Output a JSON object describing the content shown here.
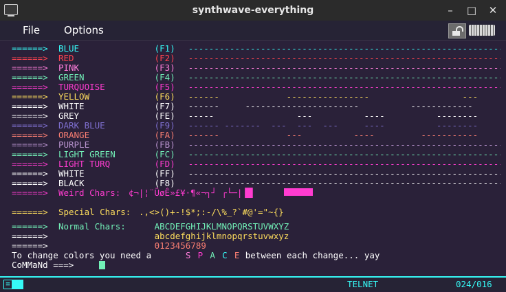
{
  "window": {
    "title": "synthwave-everything"
  },
  "window_controls": {
    "minimize": "–",
    "maximize": "□",
    "close": "✕"
  },
  "menu": {
    "file": "File",
    "options": "Options"
  },
  "terminal": {
    "arrow": "======>",
    "colors": [
      {
        "name": "BLUE",
        "key": "(F1)",
        "color": "#36f9f6",
        "dash": "full"
      },
      {
        "name": "RED",
        "key": "(F2)",
        "color": "#fe4450",
        "dash": "full"
      },
      {
        "name": "PINK",
        "key": "(F3)",
        "color": "#ff7edb",
        "dash": "full"
      },
      {
        "name": "GREEN",
        "key": "(F4)",
        "color": "#72f1b8",
        "dash": "full"
      },
      {
        "name": "TURQUOISE",
        "key": "(F5)",
        "color": "#ff3cd0",
        "dash": "full"
      },
      {
        "name": "YELLOW",
        "key": "(F6)",
        "color": "#fede5d",
        "dash": "segments"
      },
      {
        "name": "WHITE",
        "key": "(F7)",
        "color": "#ffffff",
        "dash": "segments"
      },
      {
        "name": "GREY",
        "key": "(FE)",
        "color": "#ffffff",
        "dash": "segments"
      },
      {
        "name": "DARK BLUE",
        "key": "(F9)",
        "color": "#7e6fcf",
        "dash": "segments"
      },
      {
        "name": "ORANGE",
        "key": "(FA)",
        "color": "#f97e72",
        "dash": "segments"
      },
      {
        "name": "PURPLE",
        "key": "(FB)",
        "color": "#b893ce",
        "dash": "full"
      },
      {
        "name": "LIGHT GREEN",
        "key": "(FC)",
        "color": "#72f1b8",
        "dash": "full"
      },
      {
        "name": "LIGHT TURQ",
        "key": "(FD)",
        "color": "#ff3cd0",
        "dash": "full"
      },
      {
        "name": "WHITE",
        "key": "(FF)",
        "color": "#ffffff",
        "dash": "full"
      },
      {
        "name": "BLACK",
        "key": "(F8)",
        "color": "#ffffff",
        "dash": "full"
      }
    ],
    "weird_label": "Weird Chars:",
    "weird_chars": "¢¬|¦¨ÜøÊ»£¥·¶«¬┐┘ ┌└─|▐█",
    "special_label": "Special Chars:",
    "special_chars": ".,<>()+-!$*;:-/\\%_?`#@'=\"~{}",
    "normal_label": "Normal Chars:",
    "normal_upper": "ABCDEFGHIJKLMNOPQRSTUVWXYZ",
    "normal_lower": "abcdefghijklmnopqrstuvwxyz",
    "normal_digits": "0123456789",
    "instruction_prefix": "To change colors you need a",
    "space_letters": [
      "S",
      "P",
      "A",
      "C",
      "E"
    ],
    "instruction_suffix": "between each change... yay",
    "prompt": "CoMMaNd ===>"
  },
  "status": {
    "protocol": "TELNET",
    "position": "024/016"
  }
}
